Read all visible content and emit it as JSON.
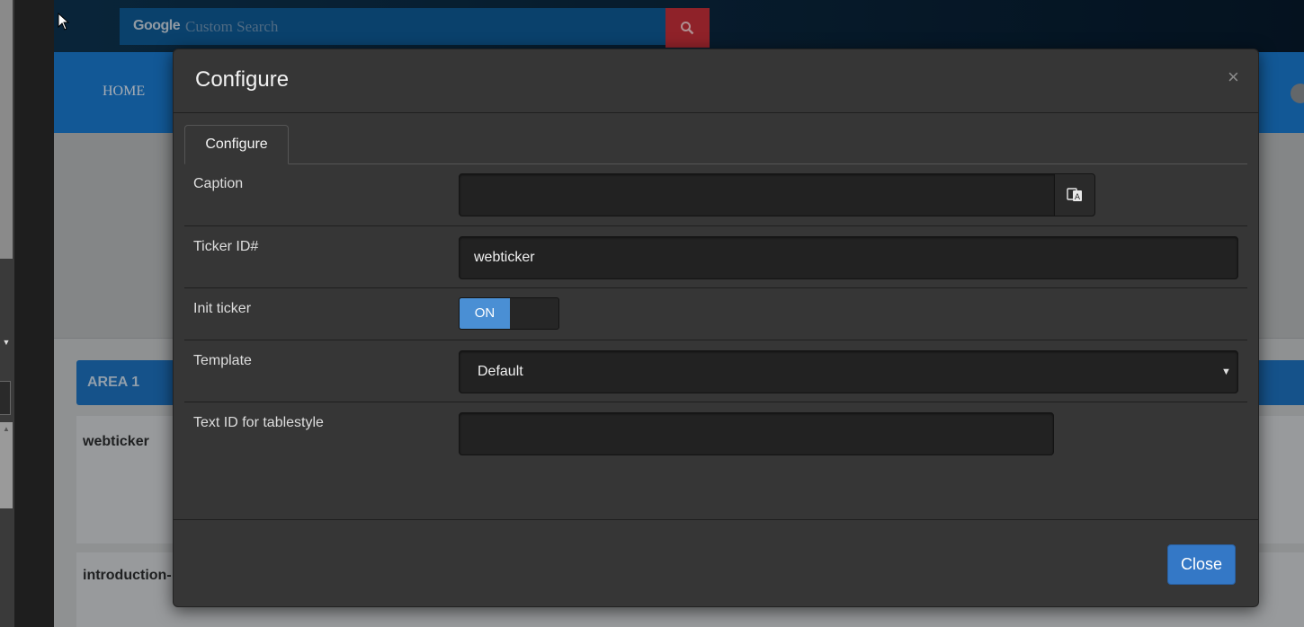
{
  "site": {
    "search": {
      "logo_text": "Google",
      "placeholder": "Custom Search"
    },
    "nav": {
      "home_label": "HOME"
    },
    "area": {
      "title": "AREA 1",
      "cards": [
        "webticker",
        "introduction-"
      ]
    }
  },
  "modal": {
    "title": "Configure",
    "close_icon": "×",
    "tabs": [
      {
        "label": "Configure",
        "active": true
      }
    ],
    "fields": {
      "caption": {
        "label": "Caption",
        "value": ""
      },
      "ticker_id": {
        "label": "Ticker ID#",
        "value": "webticker"
      },
      "init_ticker": {
        "label": "Init ticker",
        "state": "ON"
      },
      "template": {
        "label": "Template",
        "selected": "Default"
      },
      "text_id": {
        "label": "Text ID for tablestyle",
        "value": ""
      }
    },
    "footer": {
      "close_label": "Close"
    }
  },
  "colors": {
    "accent_blue": "#1a7ad0",
    "search_red": "#c6303a",
    "modal_bg": "#363636",
    "toggle_on": "#4a8fd4",
    "close_button": "#3478c6"
  },
  "icons": [
    "search-icon",
    "close-icon",
    "translate-icon",
    "dropdown-arrow-icon",
    "mouse-cursor-icon"
  ]
}
